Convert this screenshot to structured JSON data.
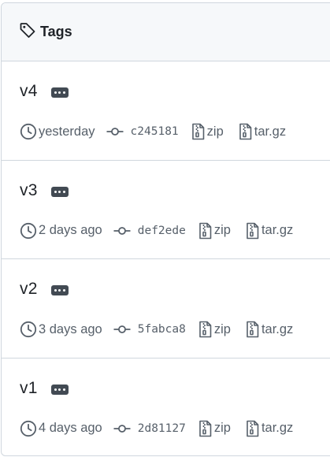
{
  "header": {
    "title": "Tags",
    "icon": "tag-icon"
  },
  "tags": [
    {
      "name": "v4",
      "date": "yesterday",
      "commit": "c245181",
      "zip_label": "zip",
      "targz_label": "tar.gz"
    },
    {
      "name": "v3",
      "date": "2 days ago",
      "commit": "def2ede",
      "zip_label": "zip",
      "targz_label": "tar.gz"
    },
    {
      "name": "v2",
      "date": "3 days ago",
      "commit": "5fabca8",
      "zip_label": "zip",
      "targz_label": "tar.gz"
    },
    {
      "name": "v1",
      "date": "4 days ago",
      "commit": "2d81127",
      "zip_label": "zip",
      "targz_label": "tar.gz"
    }
  ],
  "colors": {
    "text": "#1f2328",
    "muted": "#57606a",
    "border": "#d0d7de",
    "header_bg": "#f6f8fa",
    "ellipsis_bg": "#424a53"
  }
}
